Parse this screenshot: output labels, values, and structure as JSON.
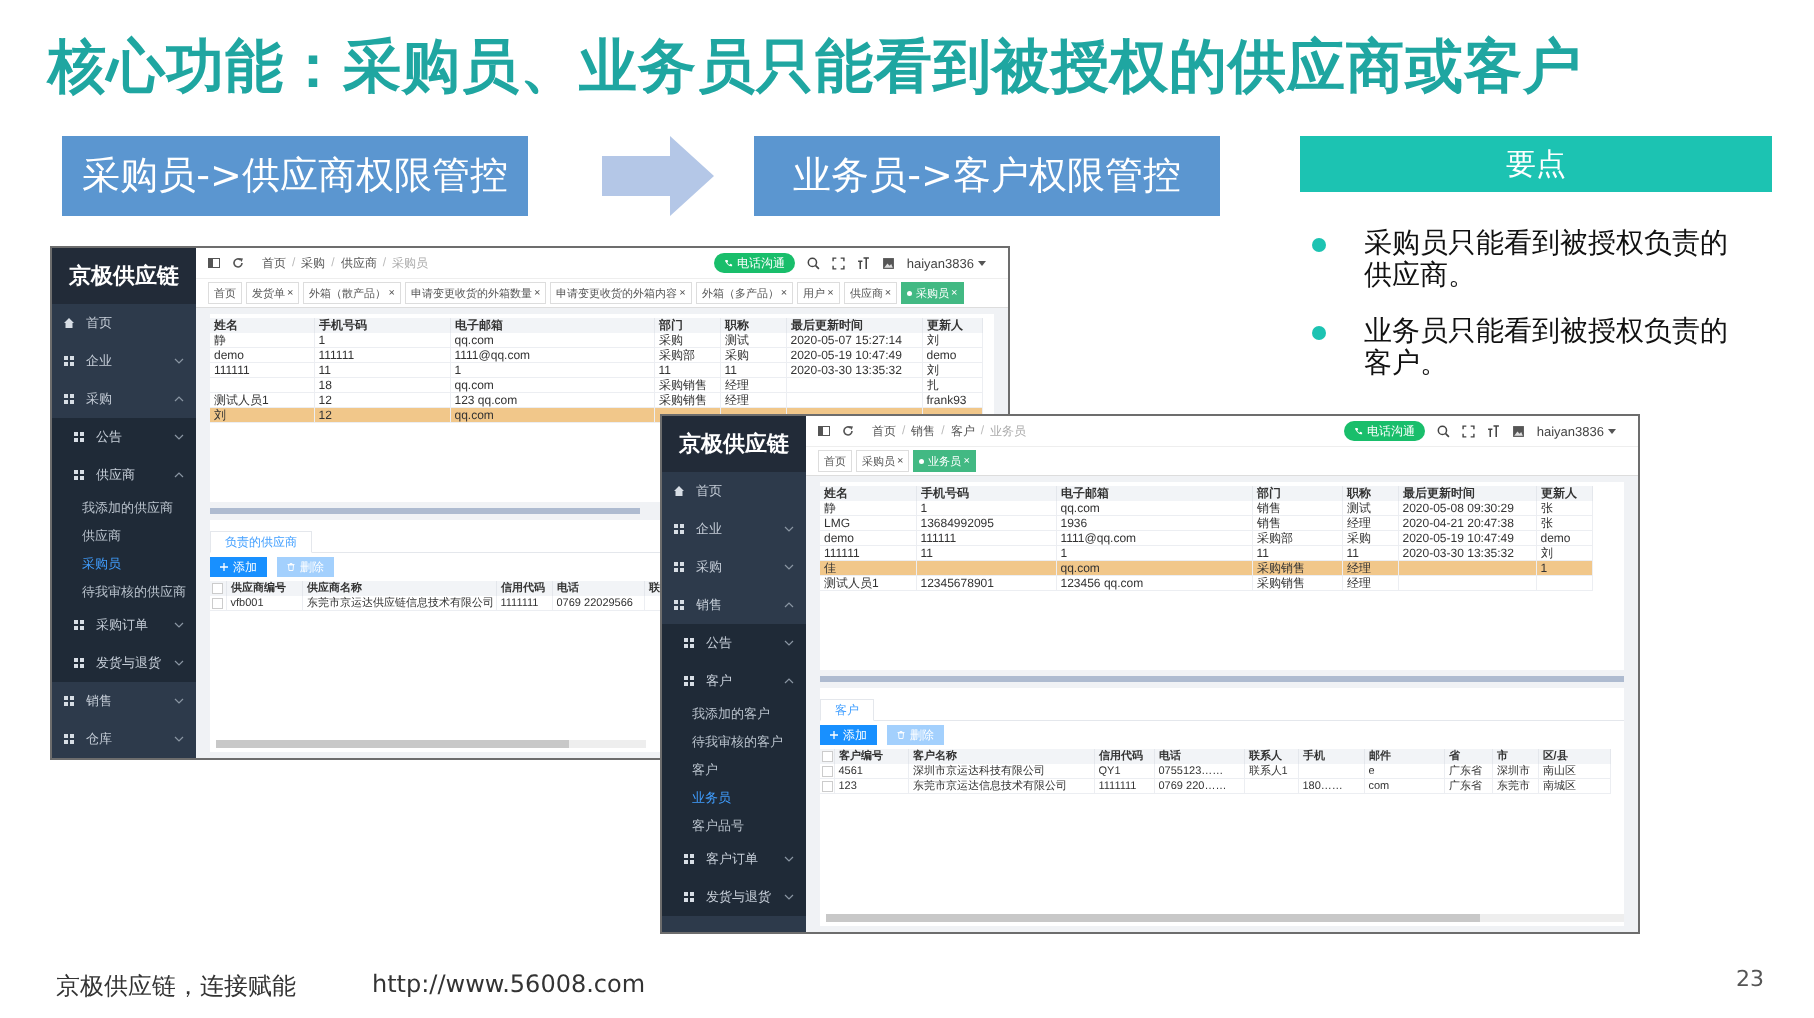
{
  "title": "核心功能：采购员、业务员只能看到被授权的供应商或客户",
  "flow": [
    {
      "label": "采购员->供应商权限管控"
    },
    {
      "label": "业务员->客户权限管控"
    }
  ],
  "key_points": {
    "heading": "要点",
    "items": [
      "采购员只能看到被授权负责的供应商。",
      "业务员只能看到被授权负责的客户。"
    ]
  },
  "screenshots": [
    {
      "brand": "京极供应链",
      "sidebar": [
        {
          "label": "首页",
          "kind": "home"
        },
        {
          "label": "企业",
          "kind": "menu",
          "expanded": false
        },
        {
          "label": "采购",
          "kind": "menu",
          "expanded": true,
          "children": [
            {
              "label": "公告",
              "kind": "menu",
              "expanded": false
            },
            {
              "label": "供应商",
              "kind": "menu",
              "expanded": true,
              "children": [
                {
                  "label": "我添加的供应商",
                  "kind": "link",
                  "selected": false
                },
                {
                  "label": "供应商",
                  "kind": "link",
                  "selected": false
                },
                {
                  "label": "采购员",
                  "kind": "link",
                  "selected": true
                },
                {
                  "label": "待我审核的供应商",
                  "kind": "link",
                  "selected": false
                }
              ]
            },
            {
              "label": "采购订单",
              "kind": "menu",
              "expanded": false
            },
            {
              "label": "发货与退货",
              "kind": "menu",
              "expanded": false
            }
          ]
        },
        {
          "label": "销售",
          "kind": "menu",
          "expanded": false
        },
        {
          "label": "仓库",
          "kind": "menu",
          "expanded": false
        }
      ],
      "breadcrumb": {
        "separator": "/",
        "items": [
          "首页",
          "采购",
          "供应商",
          "采购员"
        ]
      },
      "call_button": "电话沟通",
      "user": "haiyan3836",
      "tags": [
        {
          "label": "首页",
          "selected": false
        },
        {
          "label": "发货单",
          "close": "×",
          "selected": false
        },
        {
          "label": "外箱（散产品）",
          "close": "×",
          "selected": false
        },
        {
          "label": "申请变更收货的外箱数量",
          "close": "×",
          "selected": false
        },
        {
          "label": "申请变更收货的外箱内容",
          "close": "×",
          "selected": false
        },
        {
          "label": "外箱（多产品）",
          "close": "×",
          "selected": false
        },
        {
          "label": "用户",
          "close": "×",
          "selected": false
        },
        {
          "label": "供应商",
          "close": "×",
          "selected": false
        },
        {
          "label": "采购员",
          "close": "×",
          "selected": true
        }
      ],
      "table": {
        "columns": [
          "姓名",
          "手机号码",
          "电子邮箱",
          "部门",
          "职称",
          "最后更新时间",
          "更新人"
        ],
        "rows": [
          {
            "cells": [
              "静",
              "1",
              "qq.com",
              "采购",
              "测试",
              "2020-05-07 15:27:14",
              "刘"
            ],
            "selected": false
          },
          {
            "cells": [
              "demo",
              "111111",
              "1111@qq.com",
              "采购部",
              "采购",
              "2020-05-19 10:47:49",
              "demo"
            ],
            "selected": false
          },
          {
            "cells": [
              "111111",
              "11",
              "1",
              "11",
              "11",
              "2020-03-30 13:35:32",
              "刘"
            ],
            "selected": false
          },
          {
            "cells": [
              null,
              "18",
              "qq.com",
              "采购销售",
              "经理",
              null,
              "扎"
            ],
            "selected": false
          },
          {
            "cells": [
              "测试人员1",
              "12",
              "123 qq.com",
              "采购销售",
              "经理",
              null,
              "frank93"
            ],
            "selected": false
          },
          {
            "cells": [
              "刘",
              "12",
              "qq.com",
              null,
              null,
              null,
              null
            ],
            "selected": true
          }
        ]
      },
      "panel": {
        "tab": "负责的供应商",
        "add_button": "添加",
        "delete_button": {
          "label": "删除",
          "disabled": true
        },
        "select_all": {
          "checked": false
        },
        "columns": [
          "供应商编号",
          "供应商名称",
          "信用代码",
          "电话",
          "联"
        ],
        "rows": [
          {
            "cells": [
              "vfb001",
              "东莞市京运达供应链信息技术有限公司",
              "1111111",
              "0769 22029566",
              null
            ],
            "checked": false
          }
        ]
      }
    },
    {
      "brand": "京极供应链",
      "sidebar": [
        {
          "label": "首页",
          "kind": "home"
        },
        {
          "label": "企业",
          "kind": "menu",
          "expanded": false
        },
        {
          "label": "采购",
          "kind": "menu",
          "expanded": false
        },
        {
          "label": "销售",
          "kind": "menu",
          "expanded": true,
          "children": [
            {
              "label": "公告",
              "kind": "menu",
              "expanded": false
            },
            {
              "label": "客户",
              "kind": "menu",
              "expanded": true,
              "children": [
                {
                  "label": "我添加的客户",
                  "kind": "link",
                  "selected": false
                },
                {
                  "label": "待我审核的客户",
                  "kind": "link",
                  "selected": false
                },
                {
                  "label": "客户",
                  "kind": "link",
                  "selected": false
                },
                {
                  "label": "业务员",
                  "kind": "link",
                  "selected": true
                },
                {
                  "label": "客户品号",
                  "kind": "link",
                  "selected": false
                }
              ]
            },
            {
              "label": "客户订单",
              "kind": "menu",
              "expanded": false
            },
            {
              "label": "发货与退货",
              "kind": "menu",
              "expanded": false
            }
          ]
        }
      ],
      "breadcrumb": {
        "separator": "/",
        "items": [
          "首页",
          "销售",
          "客户",
          "业务员"
        ]
      },
      "call_button": "电话沟通",
      "user": "haiyan3836",
      "tags": [
        {
          "label": "首页",
          "selected": false
        },
        {
          "label": "采购员",
          "close": "×",
          "selected": false
        },
        {
          "label": "业务员",
          "close": "×",
          "selected": true
        }
      ],
      "table": {
        "columns": [
          "姓名",
          "手机号码",
          "电子邮箱",
          "部门",
          "职称",
          "最后更新时间",
          "更新人"
        ],
        "rows": [
          {
            "cells": [
              "静",
              "1",
              "qq.com",
              "销售",
              "测试",
              "2020-05-08 09:30:29",
              "张"
            ],
            "selected": false
          },
          {
            "cells": [
              "LMG",
              "13684992095",
              "1936",
              "销售",
              "经理",
              "2020-04-21 20:47:38",
              "张"
            ],
            "selected": false
          },
          {
            "cells": [
              "demo",
              "111111",
              "1111@qq.com",
              "采购部",
              "采购",
              "2020-05-19 10:47:49",
              "demo"
            ],
            "selected": false
          },
          {
            "cells": [
              "111111",
              "11",
              "1",
              "11",
              "11",
              "2020-03-30 13:35:32",
              "刘"
            ],
            "selected": false
          },
          {
            "cells": [
              "佳",
              null,
              "qq.com",
              "采购销售",
              "经理",
              null,
              "1"
            ],
            "selected": true
          },
          {
            "cells": [
              "测试人员1",
              "12345678901",
              "123456 qq.com",
              "采购销售",
              "经理",
              null,
              null
            ],
            "selected": false
          }
        ]
      },
      "panel": {
        "tab": "客户",
        "add_button": "添加",
        "delete_button": {
          "label": "删除",
          "disabled": true
        },
        "select_all": {
          "checked": false
        },
        "columns": [
          "客户编号",
          "客户名称",
          "信用代码",
          "电话",
          "联系人",
          "手机",
          "邮件",
          "省",
          "市",
          "区/县"
        ],
        "rows": [
          {
            "cells": [
              "4561",
              "深圳市京运达科技有限公司",
              "QY1",
              "0755123……",
              "联系人1",
              null,
              "e",
              "广东省",
              "深圳市",
              "南山区"
            ],
            "checked": false
          },
          {
            "cells": [
              "123",
              "东莞市京运达信息技术有限公司",
              "1111111",
              "0769 220……",
              null,
              "180……",
              "com",
              "广东省",
              "东莞市",
              "南城区"
            ],
            "checked": false
          }
        ]
      }
    }
  ],
  "footer": {
    "company": "京极供应链，连接赋能",
    "url": "http://www.56008.com",
    "page": "23"
  }
}
